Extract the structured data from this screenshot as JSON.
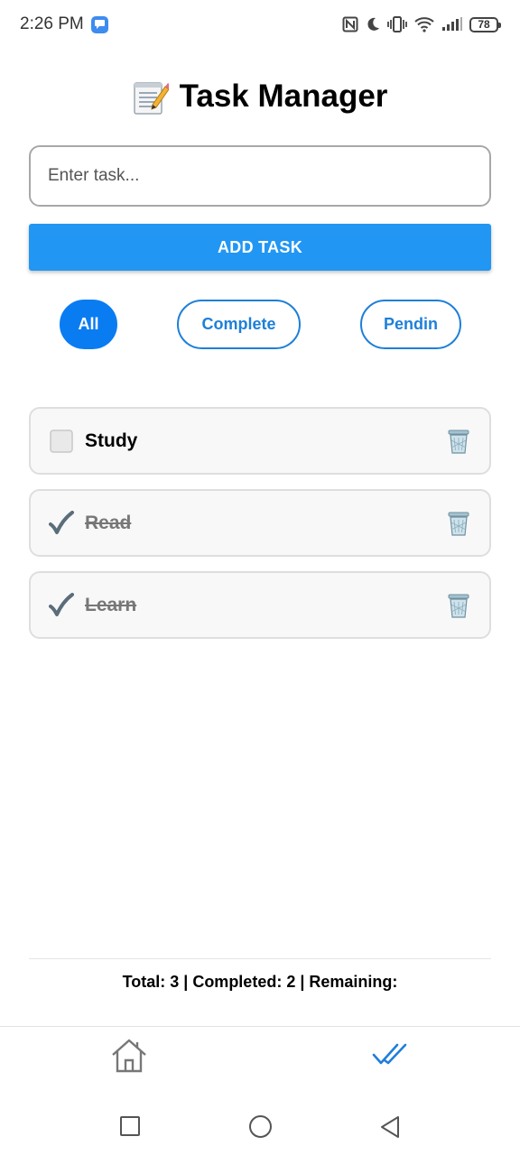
{
  "status_bar": {
    "time": "2:26 PM",
    "battery": "78"
  },
  "app": {
    "title": "Task Manager",
    "title_icon": "memo-icon"
  },
  "input": {
    "placeholder": "Enter task...",
    "value": ""
  },
  "add_button": {
    "label": "ADD TASK"
  },
  "filters": [
    {
      "label": "All",
      "active": true
    },
    {
      "label": "Complete",
      "active": false
    },
    {
      "label": "Pendin",
      "active": false
    }
  ],
  "tasks": [
    {
      "label": "Study",
      "completed": false
    },
    {
      "label": "Read",
      "completed": true
    },
    {
      "label": "Learn",
      "completed": true
    }
  ],
  "summary": {
    "text": "Total: 3 | Completed: 2 | Remaining:"
  },
  "tabbar": {
    "tabs": [
      {
        "icon": "home-icon",
        "active": false
      },
      {
        "icon": "double-check-icon",
        "active": true
      }
    ]
  },
  "colors": {
    "primary": "#2196f3",
    "filter_active": "#0a7cf2",
    "filter_outline": "#1e7fd8",
    "check": "#5a6d7a"
  }
}
